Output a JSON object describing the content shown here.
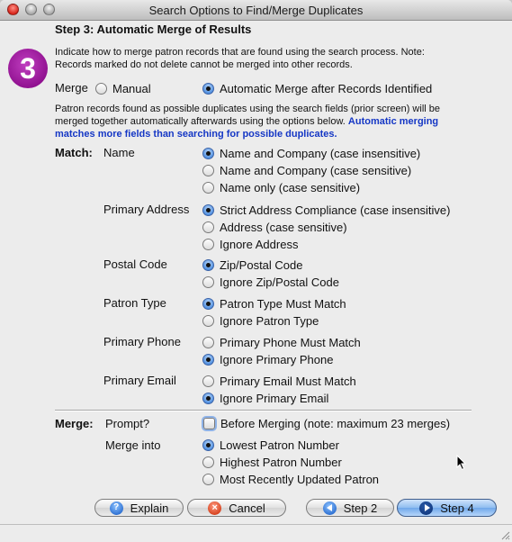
{
  "window": {
    "title": "Search Options to Find/Merge Duplicates"
  },
  "step": {
    "badge": "3",
    "title": "Step 3: Automatic Merge of Results",
    "intro_line1": "Indicate how to merge patron records that are found using the search process.  Note:",
    "intro_line2": "Records marked do not delete cannot be merged into other records."
  },
  "merge_mode": {
    "label": "Merge",
    "options": [
      {
        "label": "Manual",
        "selected": false
      },
      {
        "label": "Automatic Merge after Records Identified",
        "selected": true
      }
    ]
  },
  "info": {
    "line1": "Patron records found as possible duplicates using the search fields (prior screen) will be",
    "line2_plain": "merged together automatically afterwards using the options below.  ",
    "line2_blue": "Automatic merging",
    "line3_blue": "matches more fields than searching for possible duplicates."
  },
  "match": {
    "label": "Match:",
    "groups": [
      {
        "name": "Name",
        "options": [
          {
            "label": "Name and Company (case insensitive)",
            "selected": true
          },
          {
            "label": "Name and Company (case sensitive)",
            "selected": false
          },
          {
            "label": "Name only (case sensitive)",
            "selected": false
          }
        ]
      },
      {
        "name": "Primary Address",
        "options": [
          {
            "label": "Strict Address Compliance (case insensitive)",
            "selected": true
          },
          {
            "label": "Address (case sensitive)",
            "selected": false
          },
          {
            "label": "Ignore Address",
            "selected": false
          }
        ]
      },
      {
        "name": "Postal Code",
        "options": [
          {
            "label": "Zip/Postal Code",
            "selected": true
          },
          {
            "label": "Ignore Zip/Postal Code",
            "selected": false
          }
        ]
      },
      {
        "name": "Patron Type",
        "options": [
          {
            "label": "Patron Type Must Match",
            "selected": true
          },
          {
            "label": "Ignore Patron Type",
            "selected": false
          }
        ]
      },
      {
        "name": "Primary Phone",
        "options": [
          {
            "label": "Primary Phone Must Match",
            "selected": false
          },
          {
            "label": "Ignore Primary Phone",
            "selected": true
          }
        ]
      },
      {
        "name": "Primary Email",
        "options": [
          {
            "label": "Primary Email Must Match",
            "selected": false
          },
          {
            "label": "Ignore Primary Email",
            "selected": true
          }
        ]
      }
    ]
  },
  "merge": {
    "label": "Merge:",
    "prompt_label": "Prompt?",
    "prompt_checkbox": {
      "label": "Before Merging (note: maximum 23 merges)",
      "checked": false
    },
    "into_label": "Merge into",
    "into_options": [
      {
        "label": "Lowest Patron Number",
        "selected": true
      },
      {
        "label": "Highest Patron Number",
        "selected": false
      },
      {
        "label": "Most Recently Updated Patron",
        "selected": false
      }
    ]
  },
  "buttons": {
    "explain": "Explain",
    "cancel": "Cancel",
    "step2": "Step 2",
    "step4": "Step 4"
  }
}
